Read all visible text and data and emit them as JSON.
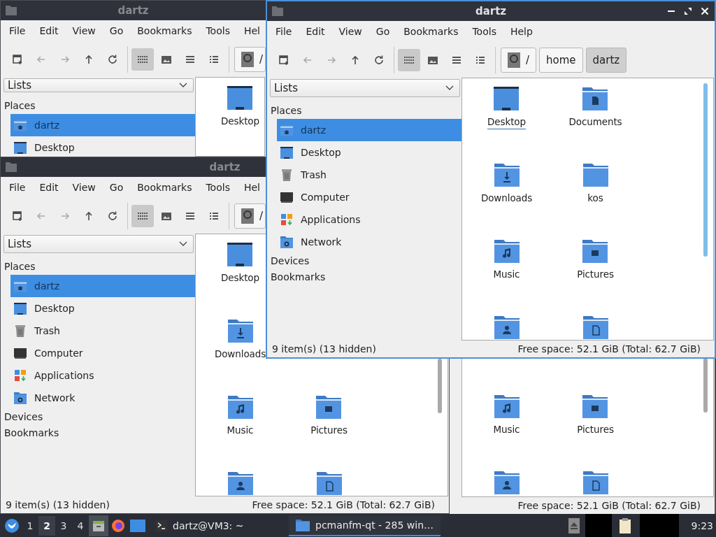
{
  "windows": [
    {
      "title": "dartz",
      "active": false,
      "menu": [
        "File",
        "Edit",
        "View",
        "Go",
        "Bookmarks",
        "Tools",
        "Hel"
      ],
      "toolbar": [
        {
          "kind": "new-tab",
          "disabled": false
        },
        {
          "kind": "back",
          "disabled": true
        },
        {
          "kind": "forward",
          "disabled": true
        },
        {
          "kind": "up",
          "disabled": false
        },
        {
          "kind": "reload",
          "disabled": false
        }
      ],
      "view_modes": [
        {
          "kind": "icons",
          "selected": true
        },
        {
          "kind": "thumbnails",
          "selected": false
        },
        {
          "kind": "compact",
          "selected": false
        },
        {
          "kind": "details",
          "selected": false
        }
      ],
      "path": [
        {
          "kind": "root",
          "label": "/",
          "selected": false
        }
      ],
      "side_pane": {
        "mode": "Lists",
        "sections": [
          {
            "title": "Places",
            "items": [
              {
                "kind": "home",
                "label": "dartz",
                "selected": true
              },
              {
                "kind": "desktop",
                "label": "Desktop",
                "selected": false
              }
            ]
          }
        ]
      },
      "rows": [
        [
          {
            "kind": "desktop",
            "label": "Desktop",
            "focused": false
          }
        ]
      ]
    },
    {
      "title": "dartz",
      "active": true,
      "controls": [
        {
          "kind": "minimize"
        },
        {
          "kind": "maximize"
        },
        {
          "kind": "close"
        }
      ],
      "menu": [
        "File",
        "Edit",
        "View",
        "Go",
        "Bookmarks",
        "Tools",
        "Help"
      ],
      "toolbar": [
        {
          "kind": "new-tab",
          "disabled": false
        },
        {
          "kind": "back",
          "disabled": true
        },
        {
          "kind": "forward",
          "disabled": true
        },
        {
          "kind": "up",
          "disabled": false
        },
        {
          "kind": "reload",
          "disabled": false
        }
      ],
      "view_modes": [
        {
          "kind": "icons",
          "selected": true
        },
        {
          "kind": "thumbnails",
          "selected": false
        },
        {
          "kind": "compact",
          "selected": false
        },
        {
          "kind": "details",
          "selected": false
        }
      ],
      "path": [
        {
          "kind": "root",
          "label": "/",
          "selected": false
        },
        {
          "kind": "dir",
          "label": "home",
          "selected": false
        },
        {
          "kind": "dir",
          "label": "dartz",
          "selected": true
        }
      ],
      "side_pane": {
        "mode": "Lists",
        "sections": [
          {
            "title": "Places",
            "items": [
              {
                "kind": "home",
                "label": "dartz",
                "selected": true
              },
              {
                "kind": "desktop",
                "label": "Desktop",
                "selected": false
              },
              {
                "kind": "trash",
                "label": "Trash",
                "selected": false
              },
              {
                "kind": "computer",
                "label": "Computer",
                "selected": false
              },
              {
                "kind": "applications",
                "label": "Applications",
                "selected": false
              },
              {
                "kind": "network",
                "label": "Network",
                "selected": false
              }
            ]
          },
          {
            "title": "Devices"
          },
          {
            "title": "Bookmarks"
          }
        ]
      },
      "rows": [
        [
          {
            "kind": "desktop",
            "label": "Desktop",
            "focused": true
          },
          {
            "kind": "documents",
            "label": "Documents",
            "focused": false
          }
        ],
        [
          {
            "kind": "downloads",
            "label": "Downloads",
            "focused": false
          },
          {
            "kind": "folder",
            "label": "kos",
            "focused": false
          }
        ],
        [
          {
            "kind": "music",
            "label": "Music",
            "focused": false
          },
          {
            "kind": "pictures",
            "label": "Pictures",
            "focused": false
          }
        ],
        [
          {
            "kind": "user"
          },
          {
            "kind": "templates"
          }
        ]
      ],
      "status": {
        "items": "9 item(s) (13 hidden)",
        "free_space": "Free space: 52.1 GiB (Total: 62.7 GiB)"
      }
    },
    {
      "title": "dartz",
      "active": false,
      "menu": [
        "File",
        "Edit",
        "View",
        "Go",
        "Bookmarks",
        "Tools",
        "Hel"
      ],
      "toolbar": [
        {
          "kind": "new-tab",
          "disabled": false
        },
        {
          "kind": "back",
          "disabled": true
        },
        {
          "kind": "forward",
          "disabled": true
        },
        {
          "kind": "up",
          "disabled": false
        },
        {
          "kind": "reload",
          "disabled": false
        }
      ],
      "view_modes": [
        {
          "kind": "icons",
          "selected": true
        },
        {
          "kind": "thumbnails",
          "selected": false
        },
        {
          "kind": "compact",
          "selected": false
        },
        {
          "kind": "details",
          "selected": false
        }
      ],
      "path": [
        {
          "kind": "root",
          "label": "/",
          "selected": false
        }
      ],
      "side_pane": {
        "mode": "Lists",
        "sections": [
          {
            "title": "Places",
            "items": [
              {
                "kind": "home",
                "label": "dartz",
                "selected": true
              },
              {
                "kind": "desktop",
                "label": "Desktop",
                "selected": false
              },
              {
                "kind": "trash",
                "label": "Trash",
                "selected": false
              },
              {
                "kind": "computer",
                "label": "Computer",
                "selected": false
              },
              {
                "kind": "applications",
                "label": "Applications",
                "selected": false
              },
              {
                "kind": "network",
                "label": "Network",
                "selected": false
              }
            ]
          },
          {
            "title": "Devices"
          },
          {
            "title": "Bookmarks"
          }
        ]
      },
      "rows": [
        [
          {
            "kind": "desktop",
            "label": "Desktop",
            "focused": false
          }
        ],
        [
          {
            "kind": "downloads",
            "label": "Downloads",
            "focused": false
          }
        ],
        [
          {
            "kind": "music",
            "label": "Music",
            "focused": false
          },
          {
            "kind": "pictures",
            "label": "Pictures",
            "focused": false
          }
        ],
        [
          {
            "kind": "user"
          },
          {
            "kind": "templates"
          }
        ]
      ],
      "status": {
        "items": "9 item(s) (13 hidden)",
        "free_space": "Free space: 52.1 GiB (Total: 62.7 GiB)"
      }
    }
  ],
  "lower_right_window": {
    "rows": [
      [
        {
          "kind": "music",
          "label": "Music"
        },
        {
          "kind": "pictures",
          "label": "Pictures"
        }
      ],
      [
        {
          "kind": "user"
        },
        {
          "kind": "templates"
        }
      ]
    ],
    "free_space": "Free space: 52.1 GiB (Total: 62.7 GiB)"
  },
  "taskbar": {
    "workspaces": [
      {
        "label": "1",
        "selected": false
      },
      {
        "label": "2",
        "selected": true
      },
      {
        "label": "3",
        "selected": false
      },
      {
        "label": "4",
        "selected": false
      }
    ],
    "launchers": [
      {
        "kind": "file-manager",
        "selected": true
      },
      {
        "kind": "browser",
        "selected": false
      },
      {
        "kind": "screen",
        "selected": false
      }
    ],
    "tasks": [
      {
        "kind": "terminal",
        "label": "dartz@VM3: ~",
        "selected": false
      },
      {
        "kind": "folder",
        "label": "pcmanfm-qt - 285 win…",
        "selected": true
      }
    ],
    "tray": [
      {
        "kind": "eject"
      },
      {
        "kind": "redacted"
      },
      {
        "kind": "clipboard"
      },
      {
        "kind": "redacted"
      }
    ],
    "clock": "9:23"
  }
}
